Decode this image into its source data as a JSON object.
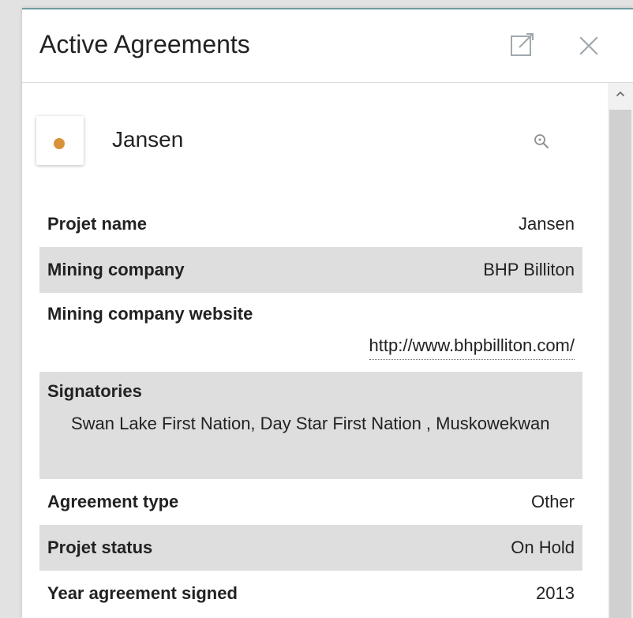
{
  "header": {
    "title": "Active Agreements"
  },
  "project": {
    "name": "Jansen",
    "marker_color": "#d8923a"
  },
  "details": {
    "project_name": {
      "label": "Projet name",
      "value": "Jansen"
    },
    "mining_company": {
      "label": "Mining company",
      "value": "BHP Billiton"
    },
    "mining_company_website": {
      "label": "Mining company website",
      "value": "http://www.bhpbilliton.com/"
    },
    "signatories": {
      "label": "Signatories",
      "value": "Swan Lake First Nation, Day Star First Nation , Muskowekwan"
    },
    "agreement_type": {
      "label": "Agreement type",
      "value": "Other"
    },
    "project_status": {
      "label": "Projet status",
      "value": "On Hold"
    },
    "year_signed": {
      "label": "Year agreement signed",
      "value": "2013"
    }
  },
  "icons": {
    "expand": "expand-icon",
    "close": "close-icon",
    "zoom": "zoom-in-icon",
    "scroll_up": "chevron-up-icon"
  }
}
